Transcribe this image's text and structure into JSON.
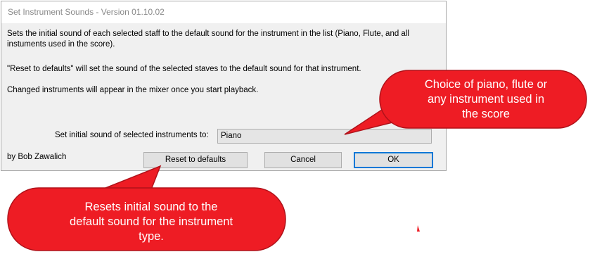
{
  "dialog": {
    "title": "Set Instrument Sounds - Version 01.10.02",
    "description": "Sets the initial sound of each selected staff to the default sound for the instrument in the list (Piano, Flute, and all instuments used in the score).",
    "reset_note": "\"Reset to defaults\" will set the sound of the selected staves to the default sound for that instrument.",
    "mixer_note": "Changed instruments will appear in the mixer once you start playback.",
    "sound_label": "Set initial sound of selected instruments to:",
    "sound_value": "Piano",
    "author": "by Bob Zawalich",
    "buttons": {
      "reset": "Reset to defaults",
      "cancel": "Cancel",
      "ok": "OK"
    }
  },
  "callouts": {
    "right": [
      "Choice of piano, flute or",
      "any instrument used in",
      "the score"
    ],
    "left": [
      "Resets initial sound to the",
      "default sound for the instrument",
      "type."
    ]
  },
  "colors": {
    "callout_fill": "#ee1c24",
    "callout_border": "#b0121a",
    "ok_border": "#0078d7"
  }
}
